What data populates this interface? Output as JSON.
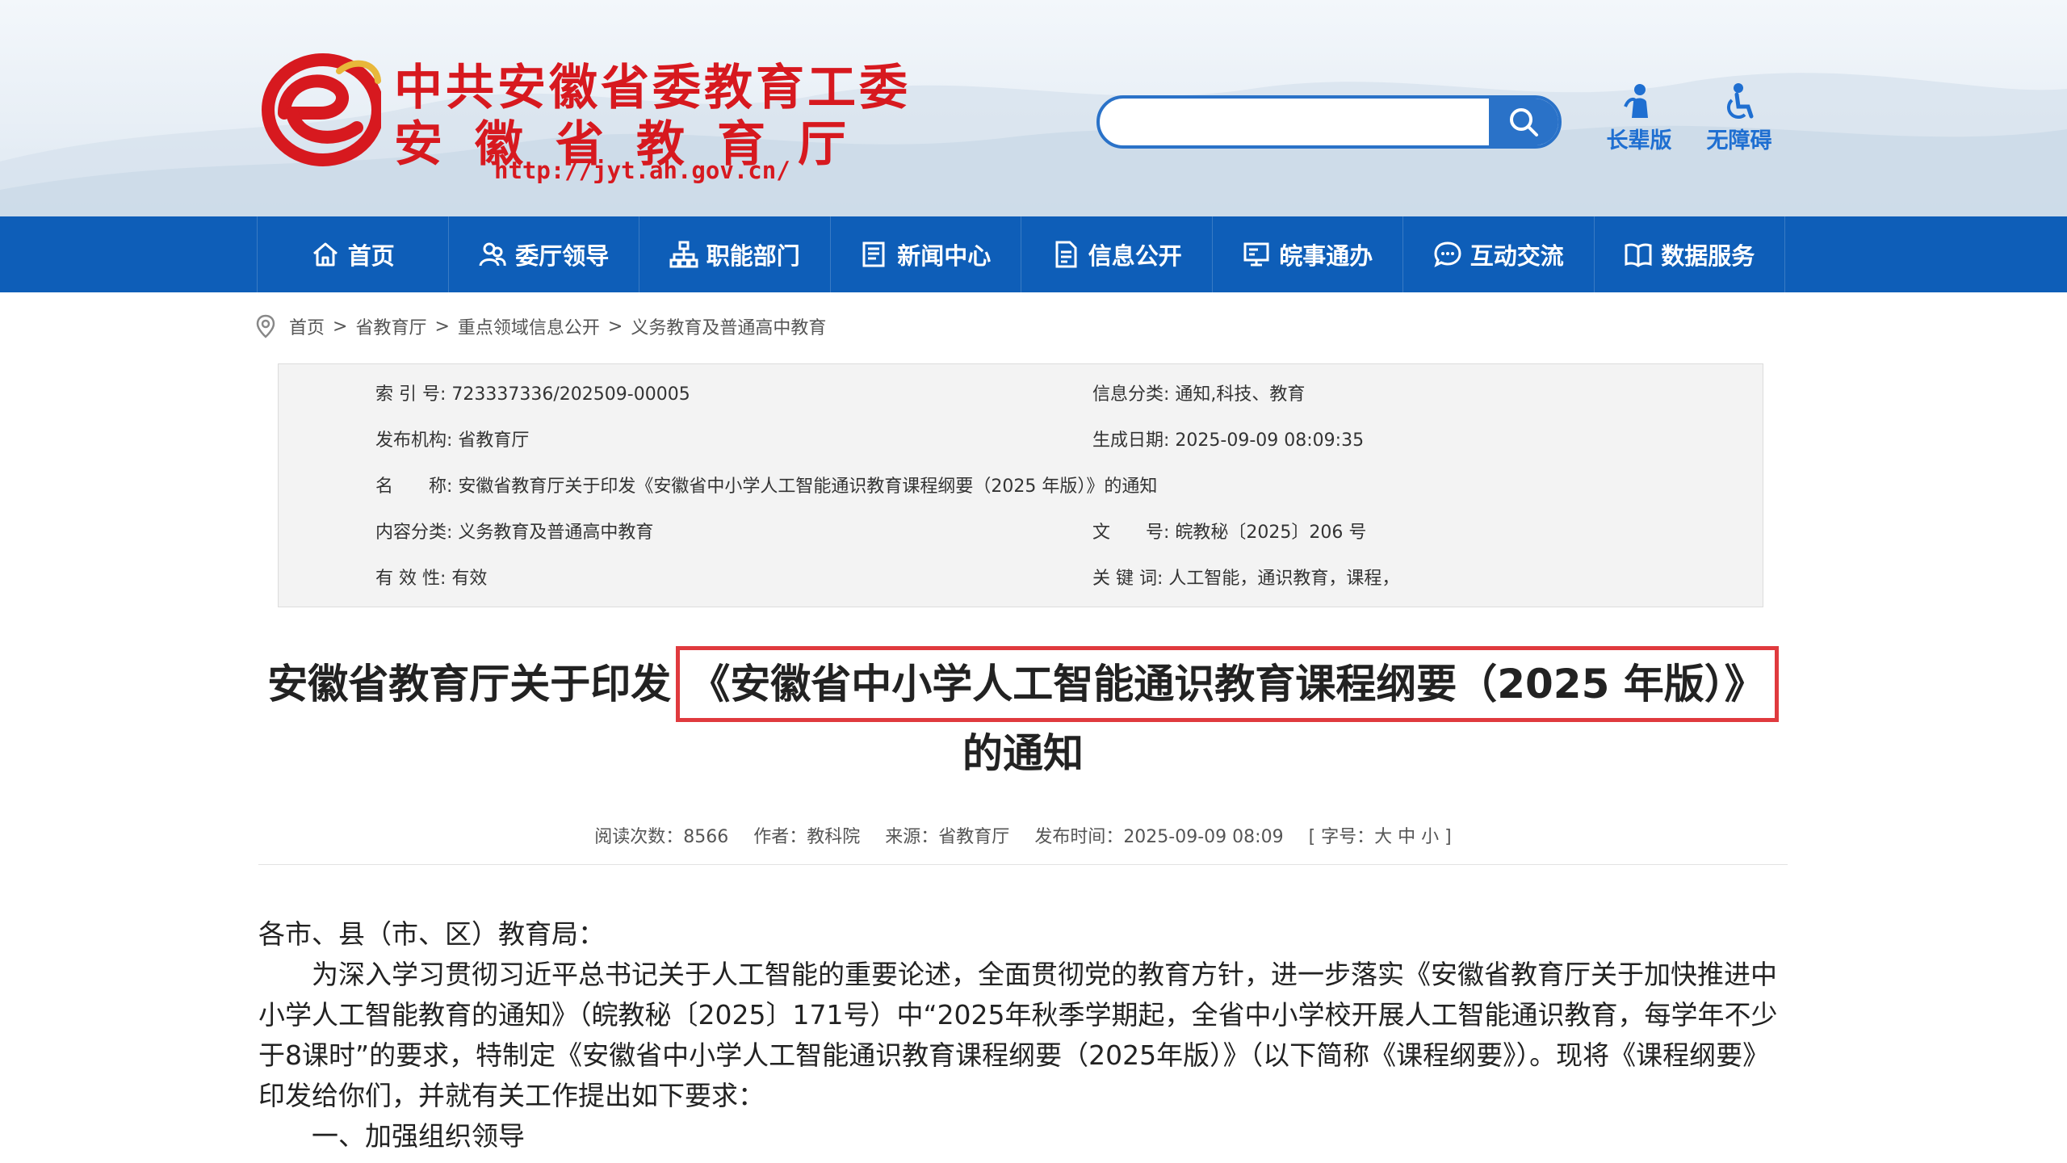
{
  "header": {
    "logo_line1": "中共安徽省委教育工委",
    "logo_line2": "安徽省教育厅",
    "logo_url": "http://jyt.ah.gov.cn/",
    "search_placeholder": "",
    "tools": [
      {
        "label": "长辈版",
        "icon": "elder-icon"
      },
      {
        "label": "无障碍",
        "icon": "accessibility-icon"
      }
    ]
  },
  "nav": [
    {
      "label": "首页",
      "icon": "home-icon"
    },
    {
      "label": "委厅领导",
      "icon": "leaders-icon"
    },
    {
      "label": "职能部门",
      "icon": "org-chart-icon"
    },
    {
      "label": "新闻中心",
      "icon": "news-icon"
    },
    {
      "label": "信息公开",
      "icon": "document-icon"
    },
    {
      "label": "皖事通办",
      "icon": "service-icon"
    },
    {
      "label": "互动交流",
      "icon": "chat-icon"
    },
    {
      "label": "数据服务",
      "icon": "book-icon"
    }
  ],
  "breadcrumb": [
    "首页",
    "省教育厅",
    "重点领域信息公开",
    "义务教育及普通高中教育"
  ],
  "info": {
    "index_label": "索 引 号:",
    "index_value": "723337336/202509-00005",
    "category_label": "信息分类:",
    "category_value": "通知,科技、教育",
    "publisher_label": "发布机构:",
    "publisher_value": "省教育厅",
    "created_label": "生成日期:",
    "created_value": "2025-09-09 08:09:35",
    "name_label": "名　　称:",
    "name_value": "安徽省教育厅关于印发《安徽省中小学人工智能通识教育课程纲要（2025 年版）》的通知",
    "content_label": "内容分类:",
    "content_value": "义务教育及普通高中教育",
    "docno_label": "文　　号:",
    "docno_value": "皖教秘〔2025〕206 号",
    "validity_label": "有 效 性:",
    "validity_value": "有效",
    "keywords_label": "关 键 词:",
    "keywords_value": "人工智能，通识教育，课程，"
  },
  "title": {
    "prefix": "安徽省教育厅关于印发",
    "highlight": "《安徽省中小学人工智能通识教育课程纲要（2025 年版）》",
    "suffix": "的通知"
  },
  "meta": {
    "reads": "阅读次数：8566",
    "author": "作者：教科院",
    "source": "来源：省教育厅",
    "time": "发布时间：2025-09-09 08:09",
    "fontsize": "[ 字号：大 中 小 ]"
  },
  "body": {
    "salutation": "各市、县（市、区）教育局：",
    "para1": "为深入学习贯彻习近平总书记关于人工智能的重要论述，全面贯彻党的教育方针，进一步落实《安徽省教育厅关于加快推进中小学人工智能教育的通知》（皖教秘〔2025〕171号）中“2025年秋季学期起，全省中小学校开展人工智能通识教育，每学年不少于8课时”的要求，特制定《安徽省中小学人工智能通识教育课程纲要（2025年版）》（以下简称《课程纲要》）。现将《课程纲要》印发给你们，并就有关工作提出如下要求：",
    "heading1": "一、加强组织领导"
  },
  "colors": {
    "brand_red": "#d7191f",
    "nav_blue": "#0e5eb8",
    "highlight_border": "#e03a3e"
  }
}
